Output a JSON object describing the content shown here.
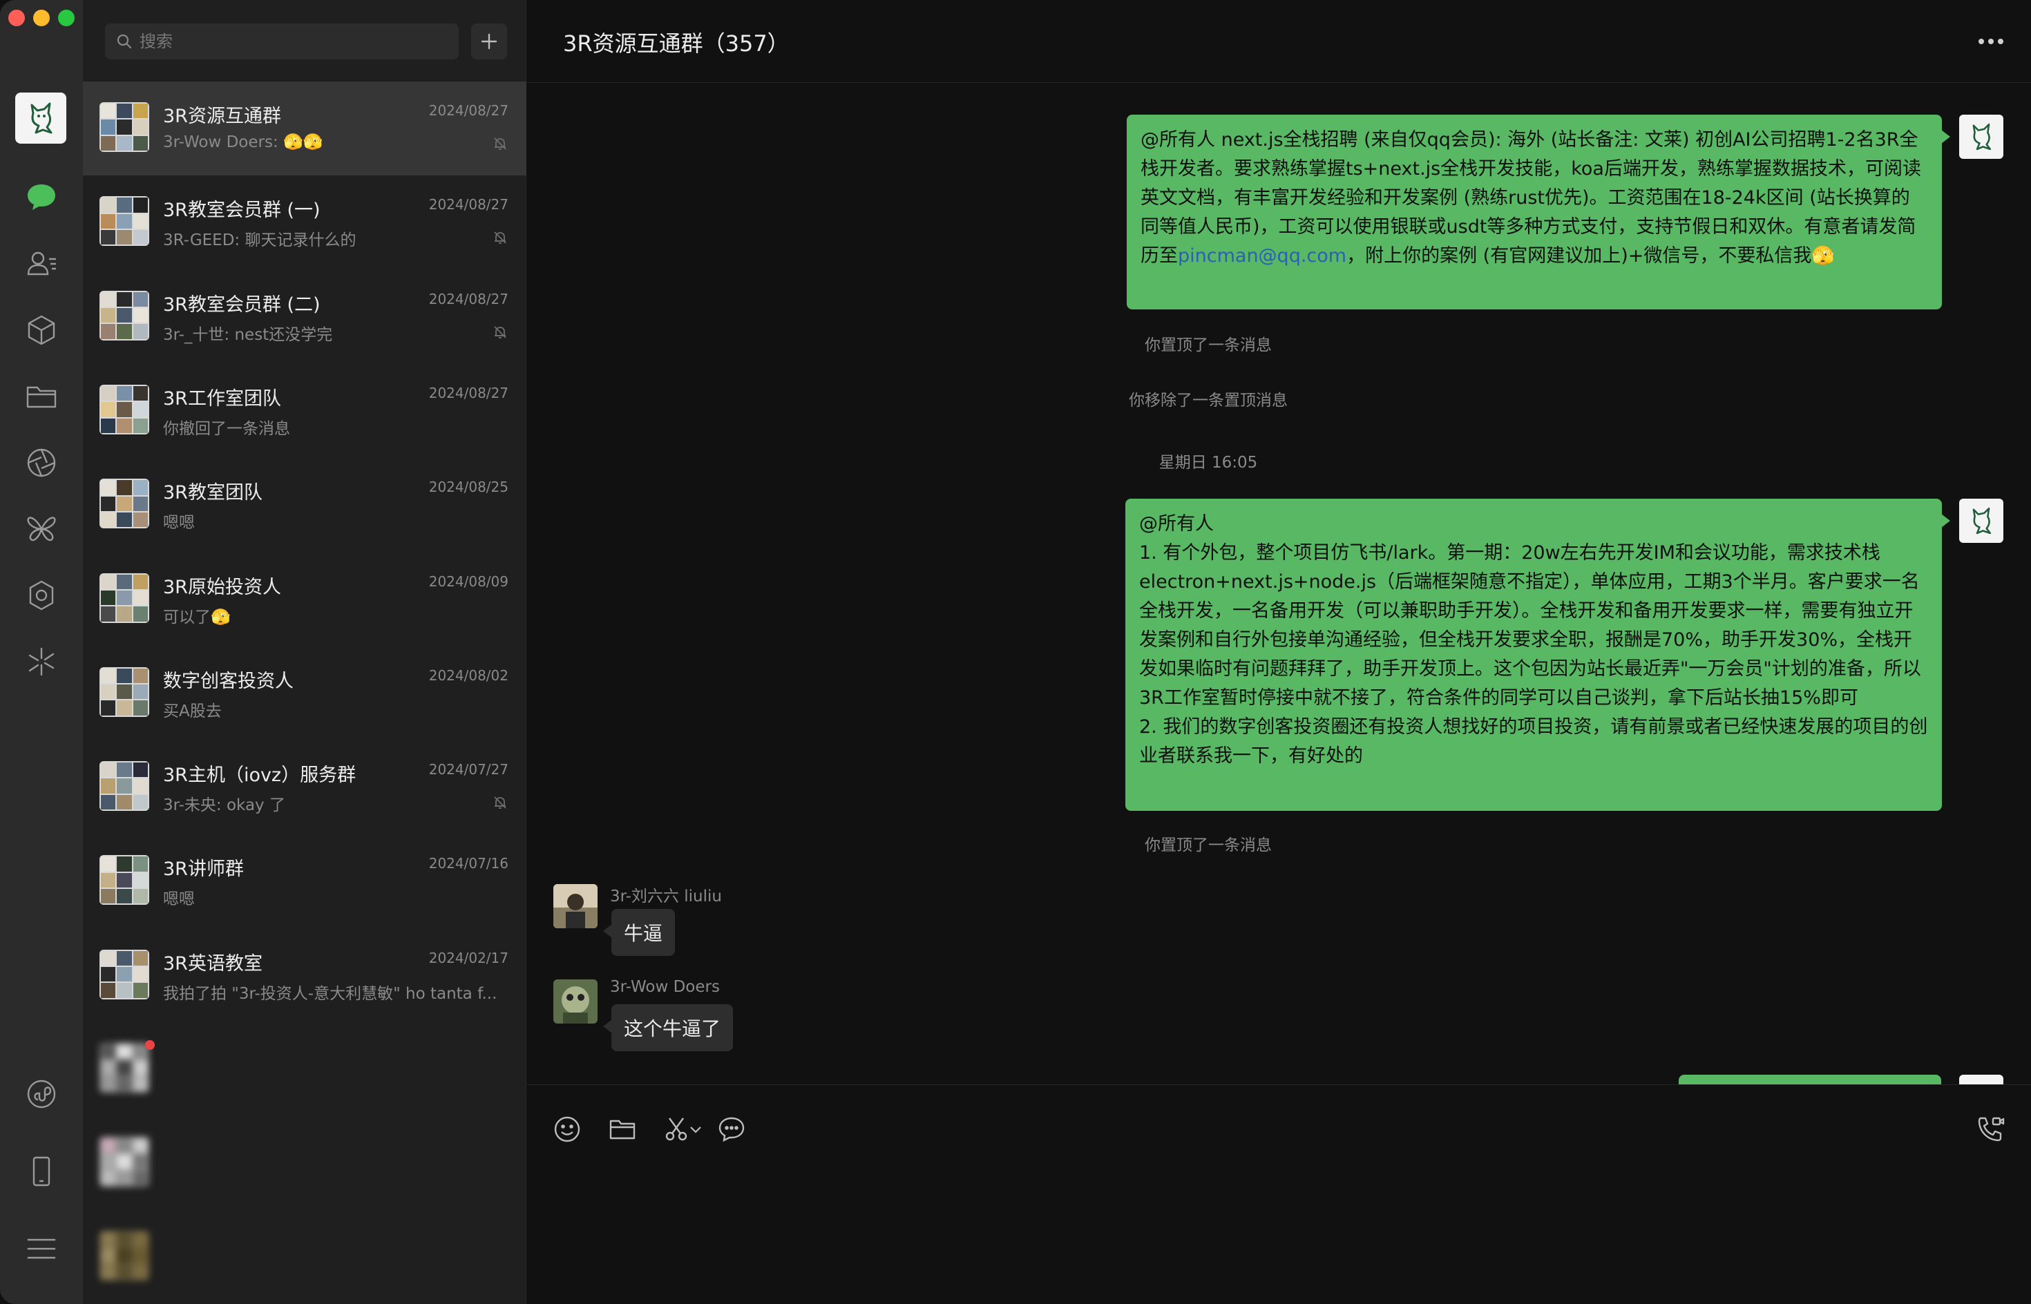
{
  "colors": {
    "accent_green": "#59b863",
    "rail_bg": "#2b2b2b",
    "list_bg": "#1f1f1f",
    "chat_bg": "#111111"
  },
  "search": {
    "placeholder": "搜索"
  },
  "rail_icons": [
    "chat-icon",
    "contacts-icon",
    "cube-icon",
    "folder-icon",
    "aperture-icon",
    "butterfly-icon",
    "flower-icon",
    "sparkle-icon",
    "mini-program-icon",
    "phone-icon",
    "menu-icon"
  ],
  "conversations": [
    {
      "name": "3R资源互通群",
      "preview": "3r-Wow Doers: 🫣🫣",
      "date": "2024/08/27",
      "muted": true,
      "active": true
    },
    {
      "name": "3R教室会员群 (一)",
      "preview": "3R-GEED: 聊天记录什么的",
      "date": "2024/08/27",
      "muted": true
    },
    {
      "name": "3R教室会员群 (二)",
      "preview": "3r-_十世: nest还没学完",
      "date": "2024/08/27",
      "muted": true
    },
    {
      "name": "3R工作室团队",
      "preview": "你撤回了一条消息",
      "date": "2024/08/27",
      "muted": false
    },
    {
      "name": "3R教室团队",
      "preview": "嗯嗯",
      "date": "2024/08/25",
      "muted": false
    },
    {
      "name": "3R原始投资人",
      "preview": "可以了🫣",
      "date": "2024/08/09",
      "muted": false
    },
    {
      "name": "数字创客投资人",
      "preview": "买A股去",
      "date": "2024/08/02",
      "muted": false
    },
    {
      "name": "3R主机（iovz）服务群",
      "preview": "3r-未央: okay 了",
      "date": "2024/07/27",
      "muted": true
    },
    {
      "name": "3R讲师群",
      "preview": "嗯嗯",
      "date": "2024/07/16",
      "muted": false
    },
    {
      "name": "3R英语教室",
      "preview": "我拍了拍 \"3r-投资人-意大利慧敏\" ho tanta f...",
      "date": "2024/02/17",
      "muted": false
    }
  ],
  "chat": {
    "title": "3R资源互通群（357）",
    "msg1_before": "@所有人 next.js全栈招聘 (来自仅qq会员): 海外 (站长备注: 文莱) 初创AI公司招聘1-2名3R全栈开发者。要求熟练掌握ts+next.js全栈开发技能，koa后端开发，熟练掌握数据技术，可阅读英文文档，有丰富开发经验和开发案例 (熟练rust优先)。工资范围在18-24k区间 (站长换算的同等值人民币)，工资可以使用银联或usdt等多种方式支付，支持节假日和双休。有意者请发简历至",
    "msg1_email": "pincman@qq.com",
    "msg1_after": "，附上你的案例 (有官网建议加上)+微信号，不要私信我🫣",
    "sys1": "你置顶了一条消息",
    "sys2": "你移除了一条置顶消息",
    "time1": "星期日 16:05",
    "msg2": "@所有人\n1. 有个外包，整个项目仿飞书/lark。第一期：20w左右先开发IM和会议功能，需求技术栈electron+next.js+node.js（后端框架随意不指定），单体应用，工期3个半月。客户要求一名全栈开发，一名备用开发（可以兼职助手开发）。全栈开发和备用开发要求一样，需要有独立开发案例和自行外包接单沟通经验，但全栈开发要求全职，报酬是70%，助手开发30%，全栈开发如果临时有问题拜拜了，助手开发顶上。这个包因为站长最近弄\"一万会员\"计划的准备，所以3R工作室暂时停接中就不接了，符合条件的同学可以自己谈判，拿下后站长抽15%即可\n2. 我们的数字创客投资圈还有投资人想找好的项目投资，请有前景或者已经快速发展的项目的创业者联系我一下，有好处的",
    "sys3": "你置顶了一条消息",
    "sender1": "3r-刘六六 liuliu",
    "reply1": "牛逼",
    "sender2": "3r-Wow Doers",
    "reply2": "这个牛逼了"
  }
}
